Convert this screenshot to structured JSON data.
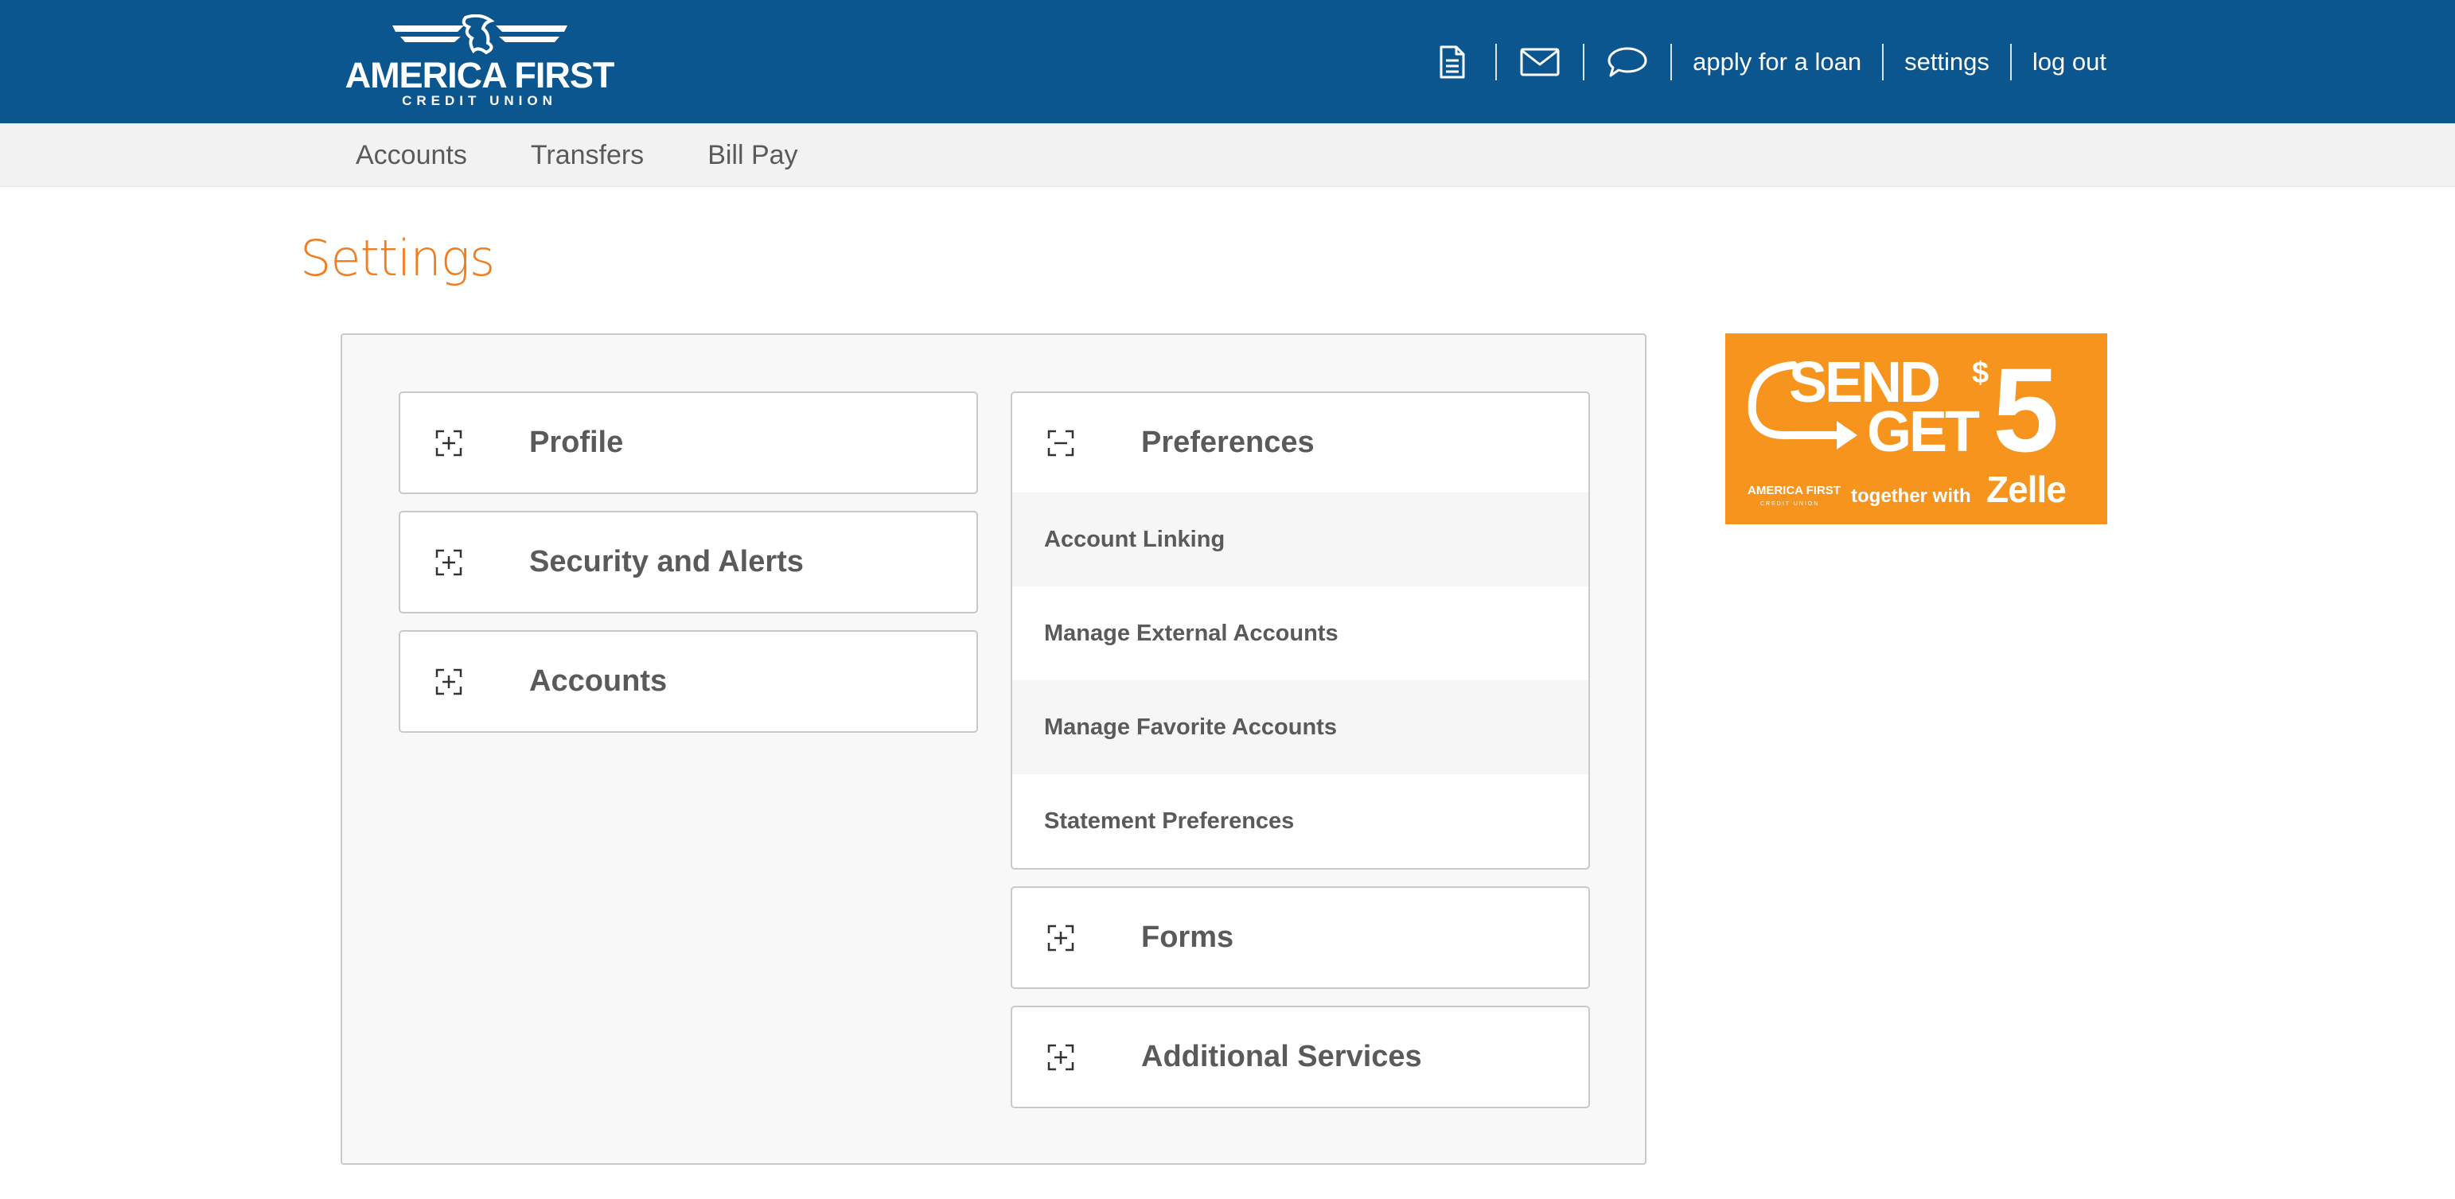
{
  "header": {
    "logo": {
      "brand": "AMERICA FIRST",
      "sub": "CREDIT UNION"
    },
    "icons": [
      {
        "name": "document-icon"
      },
      {
        "name": "mail-icon"
      },
      {
        "name": "chat-icon"
      }
    ],
    "links": {
      "apply": "apply for a loan",
      "settings": "settings",
      "logout": "log out"
    }
  },
  "nav": {
    "items": [
      "Accounts",
      "Transfers",
      "Bill Pay"
    ]
  },
  "page": {
    "title": "Settings"
  },
  "left_cards": [
    {
      "label": "Profile",
      "state": "collapsed"
    },
    {
      "label": "Security and Alerts",
      "state": "collapsed"
    },
    {
      "label": "Accounts",
      "state": "collapsed"
    }
  ],
  "right_cards": {
    "preferences": {
      "label": "Preferences",
      "state": "expanded",
      "items": [
        "Account Linking",
        "Manage External Accounts",
        "Manage Favorite Accounts",
        "Statement Preferences"
      ]
    },
    "forms": {
      "label": "Forms",
      "state": "collapsed"
    },
    "additional": {
      "label": "Additional Services",
      "state": "collapsed"
    }
  },
  "ad": {
    "line1": "SEND",
    "line2": "GET",
    "currency": "$",
    "amount": "5",
    "brand": "AMERICA FIRST",
    "brand_sub": "CREDIT UNION",
    "together": "together with",
    "partner": "Zelle"
  },
  "colors": {
    "header_bg": "#0c5690",
    "title_accent": "#f07d1e",
    "ad_bg": "#f7941d"
  }
}
